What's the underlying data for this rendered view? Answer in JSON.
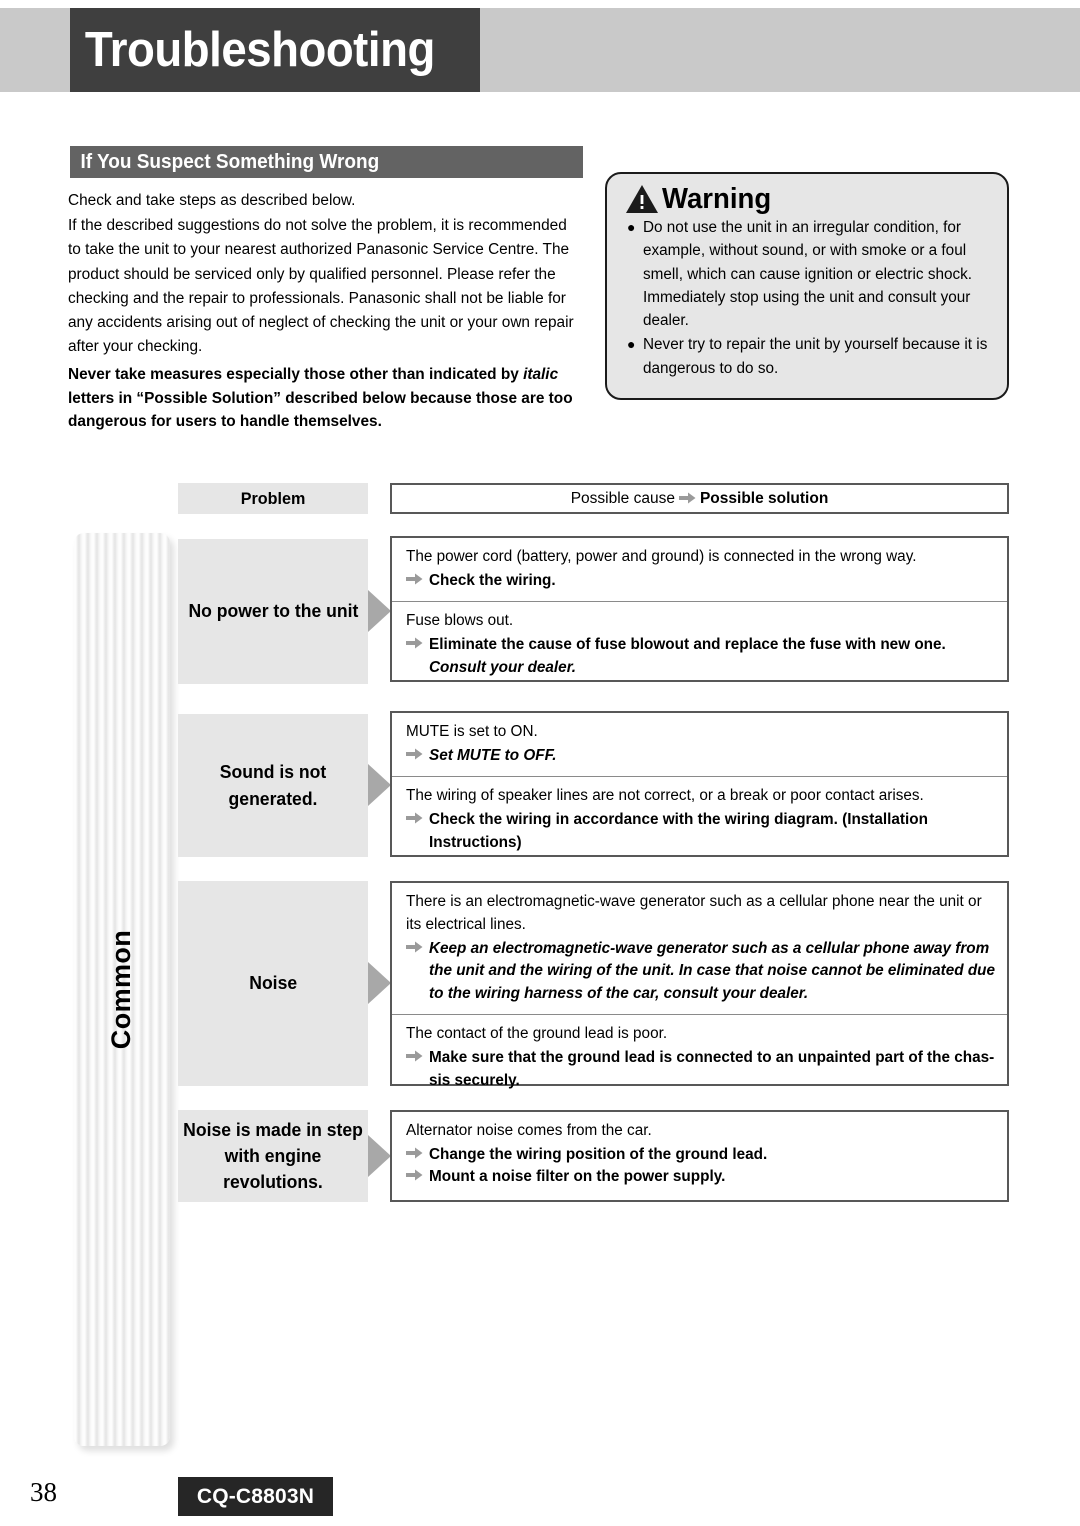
{
  "page": {
    "title": "Troubleshooting",
    "section_heading": "If You Suspect Something Wrong",
    "page_number": "38",
    "model": "CQ-C8803N",
    "side_tab_label": "Common"
  },
  "intro": {
    "line1": "Check and take steps as described below.",
    "line2": "If the described suggestions do not solve the problem, it is recommended to take the unit to your nearest authorized Panasonic Service Centre. The product should be serviced only by qualified personnel. Please refer the checking and the repair to professionals. Panasonic shall not be liable for any accidents arising out of neglect of checking the unit or your own repair after your checking.",
    "note_part1": "Never take measures especially those other than indicated by ",
    "note_italic": "italic",
    "note_part2": " letters in “Possible Solution” described below because those are too dangerous for users to handle themselves."
  },
  "warning": {
    "label": "Warning",
    "icon": "warning-triangle-icon",
    "bullets": [
      "Do not use the unit in an irregular condition, for example, without sound, or with smoke or a foul smell, which can cause ignition or electric shock. Immediately stop using the unit and consult your dealer.",
      "Never try to repair the unit by yourself because it is dangerous to do so."
    ]
  },
  "table": {
    "header_problem": "Problem",
    "header_cause_prefix": "Possible cause",
    "header_cause_suffix": "Possible solution",
    "rows": [
      {
        "problem": "No power to the unit",
        "causes": [
          {
            "cause": "The power cord (battery, power and ground) is connected in the wrong way.",
            "solutions": [
              {
                "text": "Check the wiring.",
                "italic": false
              }
            ],
            "continuation": ""
          },
          {
            "cause": "Fuse blows out.",
            "solutions": [
              {
                "text": "Eliminate the cause of fuse blowout and replace the fuse with new one.",
                "italic": false
              }
            ],
            "continuation": "Consult your dealer."
          }
        ]
      },
      {
        "problem": "Sound is not generated.",
        "causes": [
          {
            "cause": "MUTE is set to ON.",
            "solutions": [
              {
                "text": "Set MUTE to OFF.",
                "italic": true
              }
            ],
            "continuation": ""
          },
          {
            "cause": "The wiring of speaker lines are not correct, or a break or poor contact arises.",
            "solutions": [
              {
                "text": "Check the wiring in accordance with the wiring diagram. (Installation Instructions)",
                "italic": false
              }
            ],
            "continuation": ""
          }
        ]
      },
      {
        "problem": "Noise",
        "causes": [
          {
            "cause": "There is an electromagnetic-wave generator such as a cellular phone near the unit or its electrical lines.",
            "solutions": [
              {
                "text": "Keep an electromagnetic-wave generator such as a cellular phone away from the unit and the wiring of the unit. In case that noise cannot be eliminated due to the wiring harness of the car, consult your dealer.",
                "italic": true
              }
            ],
            "continuation": ""
          },
          {
            "cause": "The contact of the ground lead is poor.",
            "solutions": [
              {
                "text": "Make sure that the ground lead is connected to an unpainted part of the chas-sis securely.",
                "italic": false
              }
            ],
            "continuation": ""
          }
        ]
      },
      {
        "problem": "Noise is made in step with engine revolutions.",
        "causes": [
          {
            "cause": "Alternator noise comes from the car.",
            "solutions": [
              {
                "text": "Change the wiring position of the ground lead.",
                "italic": false
              },
              {
                "text": "Mount a noise filter on the power supply.",
                "italic": false
              }
            ],
            "continuation": ""
          }
        ]
      }
    ]
  },
  "colors": {
    "title_bg": "#3f3f3f",
    "band_bg": "#c9c9c9",
    "section_bg": "#636363",
    "cell_bg": "#e6e6e6",
    "border": "#585858",
    "arrow": "#9a9a9a"
  }
}
